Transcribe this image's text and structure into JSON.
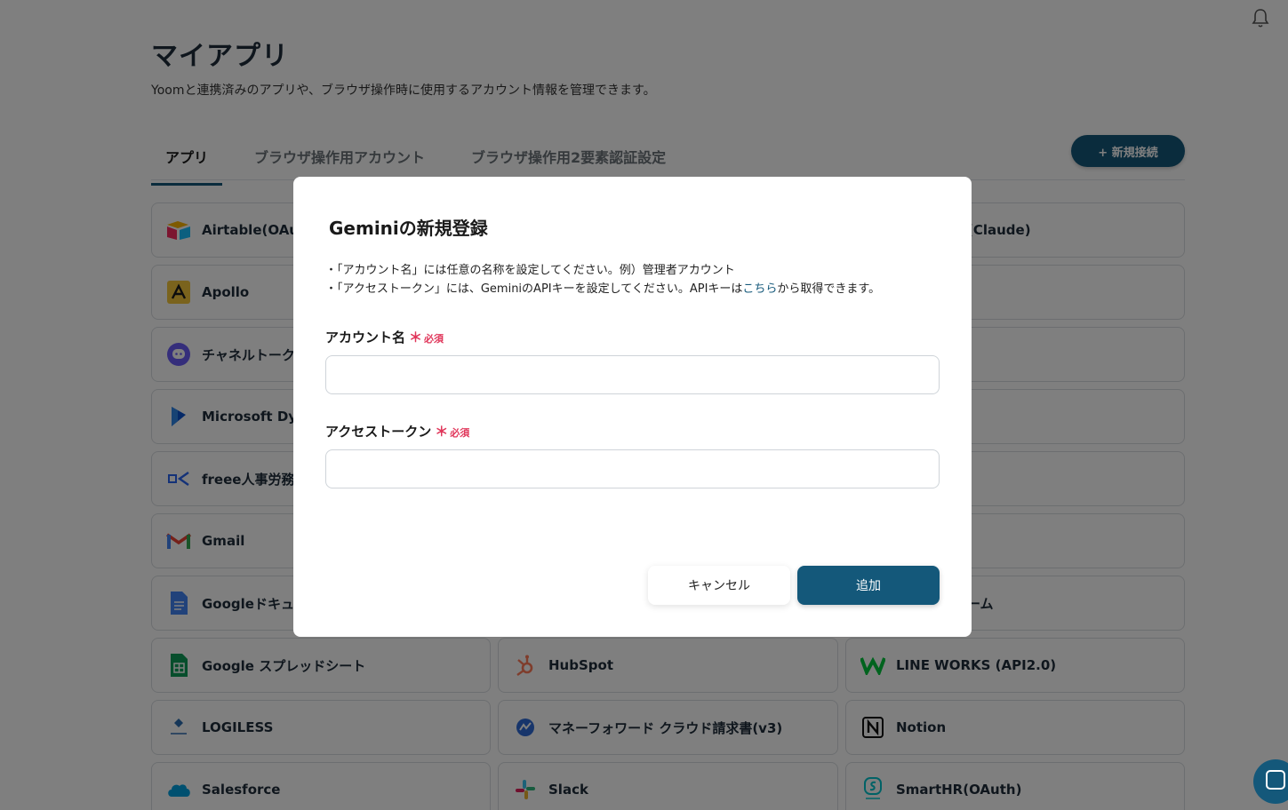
{
  "page": {
    "title": "マイアプリ",
    "subtitle": "Yoomと連携済みのアプリや、ブラウザ操作時に使用するアカウント情報を管理できます。",
    "new_connection_label": "+ 新規接続"
  },
  "tabs": [
    {
      "label": "アプリ",
      "active": true
    },
    {
      "label": "ブラウザ操作用アカウント",
      "active": false
    },
    {
      "label": "ブラウザ操作用2要素認証設定",
      "active": false
    }
  ],
  "apps": {
    "col1": [
      {
        "name": "Airtable(OAuth)",
        "icon": "airtable-icon"
      },
      {
        "name": "Apollo",
        "icon": "apollo-icon"
      },
      {
        "name": "チャネルトーク",
        "icon": "channeltalk-icon"
      },
      {
        "name": "Microsoft Dynamics",
        "icon": "microsoft-dynamics-icon"
      },
      {
        "name": "freee人事労務",
        "icon": "freee-icon"
      },
      {
        "name": "Gmail",
        "icon": "gmail-icon"
      },
      {
        "name": "Googleドキュメント",
        "icon": "google-docs-icon"
      },
      {
        "name": "Google スプレッドシート",
        "icon": "google-sheets-icon"
      },
      {
        "name": "LOGILESS",
        "icon": "logiless-icon"
      },
      {
        "name": "Salesforce",
        "icon": "salesforce-icon"
      }
    ],
    "col2": [
      {
        "name": "HubSpot",
        "icon": "hubspot-icon"
      },
      {
        "name": "マネーフォワード クラウド請求書(v3)",
        "icon": "moneyforward-icon"
      },
      {
        "name": "Slack",
        "icon": "slack-icon"
      }
    ],
    "col3_partial": [
      {
        "name": "(Claude)",
        "icon": ""
      },
      {
        "name": "ーム",
        "icon": ""
      }
    ],
    "col3": [
      {
        "name": "LINE WORKS (API2.0)",
        "icon": "lineworks-icon"
      },
      {
        "name": "Notion",
        "icon": "notion-icon"
      },
      {
        "name": "SmartHR(OAuth)",
        "icon": "smarthr-icon"
      }
    ]
  },
  "modal": {
    "title": "Geminiの新規登録",
    "note_line1": "・「アカウント名」には任意の名称を設定してください。例）管理者アカウント",
    "note_line2_pre": "・「アクセストークン」には、GeminiのAPIキーを設定してください。APIキーは",
    "note_link": "こちら",
    "note_line2_post": "から取得できます。",
    "account_label": "アカウント名",
    "token_label": "アクセストークン",
    "required_star": "＊",
    "required_text": "必須",
    "account_value": "",
    "token_value": "",
    "cancel_label": "キャンセル",
    "add_label": "追加"
  }
}
